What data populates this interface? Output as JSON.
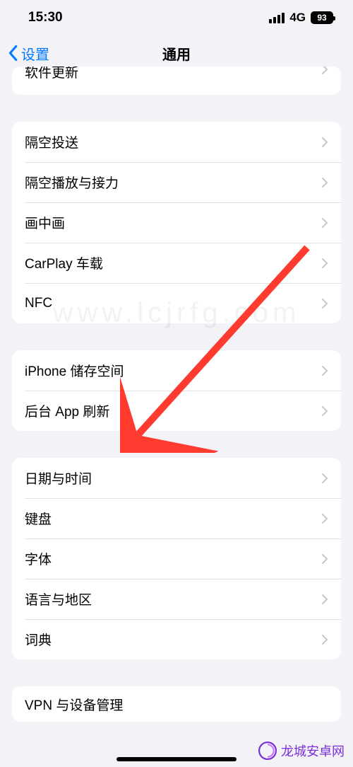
{
  "status": {
    "time": "15:30",
    "network": "4G",
    "battery": "93"
  },
  "nav": {
    "back": "设置",
    "title": "通用"
  },
  "group0": {
    "item0": "软件更新"
  },
  "group1": {
    "item0": "隔空投送",
    "item1": "隔空播放与接力",
    "item2": "画中画",
    "item3": "CarPlay 车载",
    "item4": "NFC"
  },
  "group2": {
    "item0": "iPhone 储存空间",
    "item1": "后台 App 刷新"
  },
  "group3": {
    "item0": "日期与时间",
    "item1": "键盘",
    "item2": "字体",
    "item3": "语言与地区",
    "item4": "词典"
  },
  "group4": {
    "item0": "VPN 与设备管理"
  },
  "watermark": "www.lcjrfg.com",
  "brand": "龙城安卓网"
}
